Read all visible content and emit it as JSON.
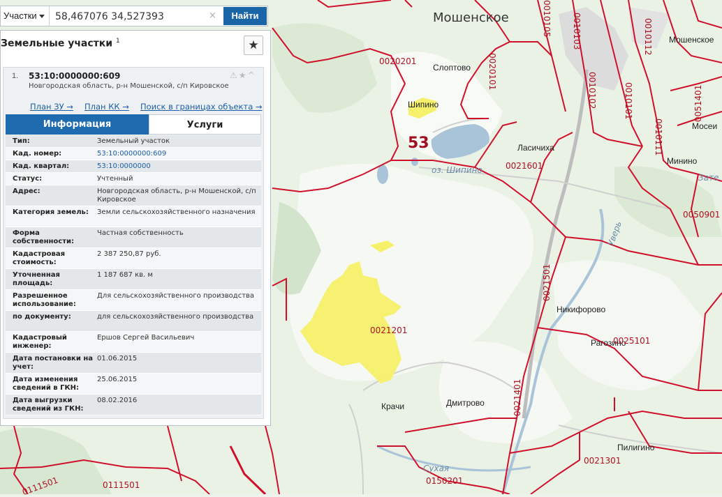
{
  "search": {
    "type_label": "Участки",
    "value": "58,467076 34,527393",
    "clear_glyph": "×",
    "find_label": "Найти"
  },
  "panel": {
    "title": "Земельные участки",
    "title_sup": "1",
    "fav_glyph": "★",
    "card": {
      "num": "1.",
      "cad_number": "53:10:0000000:609",
      "address": "Новгородская область, р-н Мошенской, с/п Кировское",
      "icons": "⚠★^",
      "links": [
        "План ЗУ →",
        "План КК →",
        "Поиск в границах объекта →"
      ],
      "tabs": [
        "Информация",
        "Услуги"
      ],
      "attributes": [
        {
          "key": "Тип:",
          "value": "Земельный участок"
        },
        {
          "key": "Кад. номер:",
          "value": "53:10:0000000:609"
        },
        {
          "key": "Кад. квартал:",
          "value": "53:10:0000000"
        },
        {
          "key": "Статус:",
          "value": "Учтенный"
        },
        {
          "key": "Адрес:",
          "value": "Новгородская область, р-н Мошенской, с/п Кировское"
        },
        {
          "key": "Категория земель:",
          "value": "Земли сельскохозяйственного назначения"
        },
        {
          "key": "Форма собственности:",
          "value": "Частная собственность"
        },
        {
          "key": "Кадастровая стоимость:",
          "value": "2 387 250,87 руб."
        },
        {
          "key": "Уточненная площадь:",
          "value": "1 187 687 кв. м"
        },
        {
          "key": "Разрешенное использование:",
          "value": "Для сельскохозяйственного производства"
        },
        {
          "key": "по документу:",
          "value": "для сельскохозяйственного производства"
        },
        {
          "key": "Кадастровый инженер:",
          "value": "Ершов Сергей Васильевич"
        },
        {
          "key": "Дата постановки на учет:",
          "value": "01.06.2015"
        },
        {
          "key": "Дата изменения сведений в ГКН:",
          "value": "25.06.2015"
        },
        {
          "key": "Дата выгрузки сведений из ГКН:",
          "value": "08.02.2016"
        }
      ]
    }
  },
  "map": {
    "settlements": [
      "Мошенское",
      "Слоптово",
      "Шипино",
      "Ласичиха",
      "Мошенское",
      "Минино",
      "Мосеи",
      "Никифорово",
      "Рагозино",
      "Крачи",
      "Дмитрово",
      "Пилигино"
    ],
    "water": [
      "оз. Шипино",
      "Уверь",
      "Сухая",
      "Зате"
    ],
    "region_number": "53",
    "quarters": [
      "0020201",
      "0020101",
      "0010105",
      "0010103",
      "0010102",
      "0010101",
      "0010112",
      "0010111",
      "0051401",
      "0021601",
      "0050901",
      "0021501",
      "0021201",
      "0021401",
      "0025101",
      "0021301",
      "0150201",
      "0111501",
      "0111501"
    ],
    "colors": {
      "boundary": "#d0102a",
      "parcel": "#f7f06a",
      "forest": "#cfe3c8",
      "water": "#a9c3d8"
    }
  }
}
